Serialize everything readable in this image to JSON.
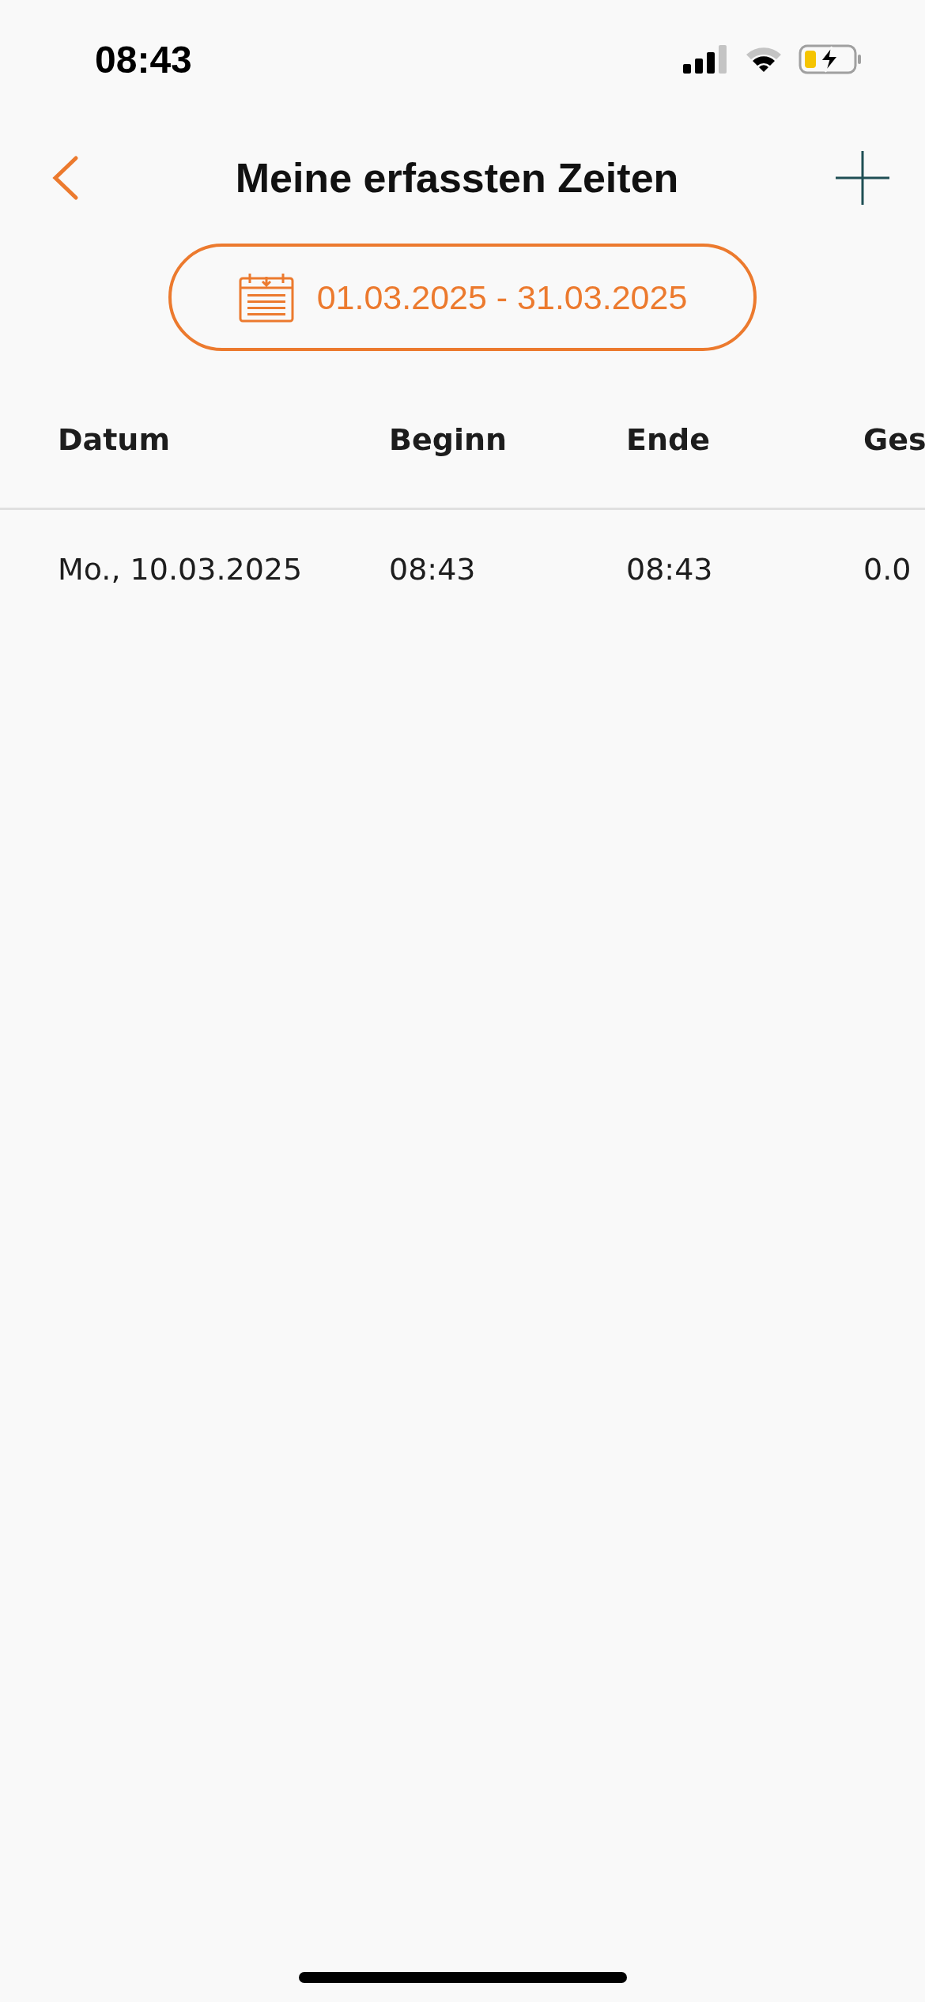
{
  "status_bar": {
    "time": "08:43"
  },
  "header": {
    "title": "Meine erfassten Zeiten"
  },
  "date_range": {
    "label": "01.03.2025 - 31.03.2025"
  },
  "table": {
    "columns": [
      "Datum",
      "Beginn",
      "Ende",
      "Ges"
    ],
    "rows": [
      [
        "Mo., 10.03.2025",
        "08:43",
        "08:43",
        "0.0"
      ]
    ]
  }
}
